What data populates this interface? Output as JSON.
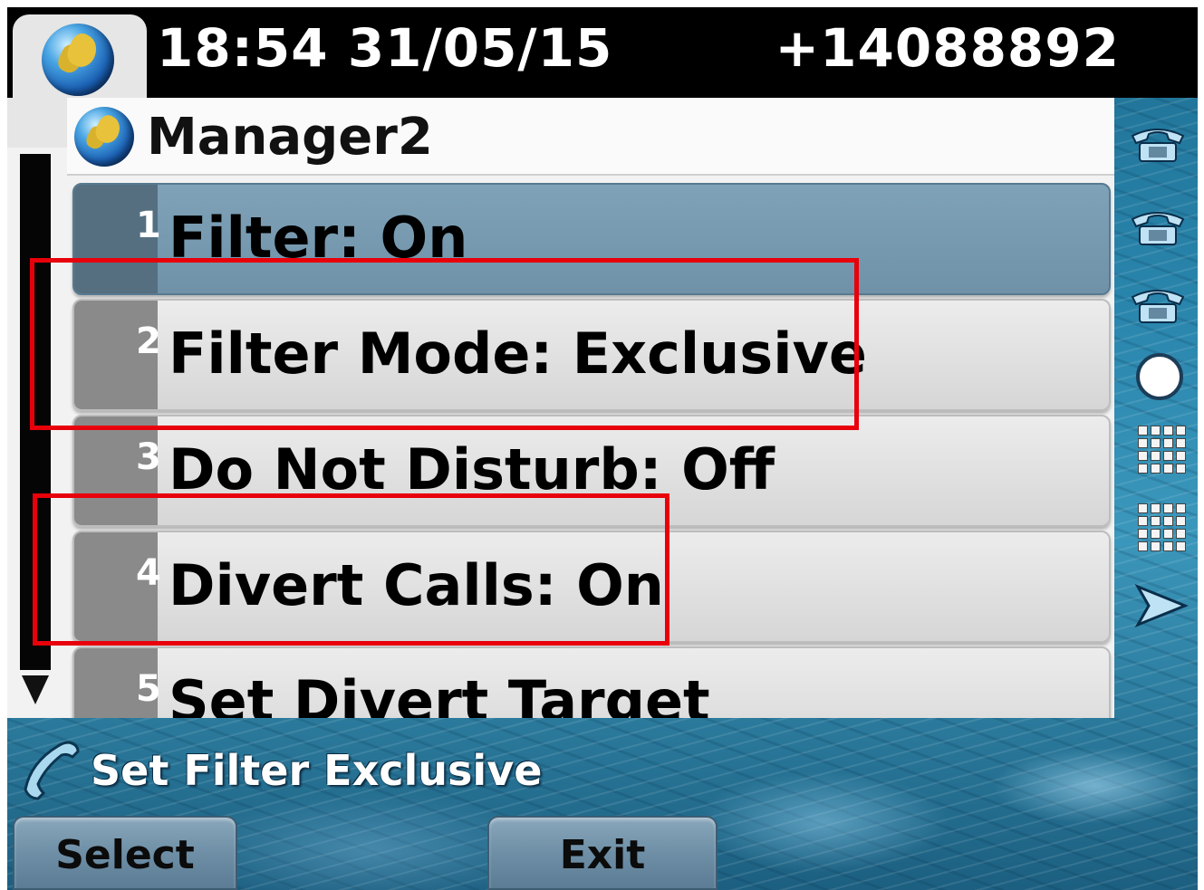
{
  "header": {
    "datetime": "18:54 31/05/15",
    "phone_number": "+14088892"
  },
  "panel": {
    "title": "Manager2",
    "items": [
      {
        "number": "1",
        "label": "Filter: On",
        "selected": true
      },
      {
        "number": "2",
        "label": "Filter Mode: Exclusive",
        "selected": false
      },
      {
        "number": "3",
        "label": "Do Not Disturb: Off",
        "selected": false
      },
      {
        "number": "4",
        "label": "Divert Calls: On",
        "selected": false
      },
      {
        "number": "5",
        "label": "Set Divert Target",
        "selected": false
      }
    ]
  },
  "status": {
    "text": "Set Filter Exclusive"
  },
  "softkeys": {
    "select_label": "Select",
    "exit_label": "Exit"
  },
  "side_icons": [
    "phone-line-icon",
    "phone-line-icon",
    "phone-line-icon",
    "circle-icon",
    "keypad-icon",
    "keypad-icon",
    "arrow-right-icon"
  ],
  "colors": {
    "highlight": "#e8000b",
    "selected_row": "#7fa2b8",
    "header_bg": "#000000"
  }
}
